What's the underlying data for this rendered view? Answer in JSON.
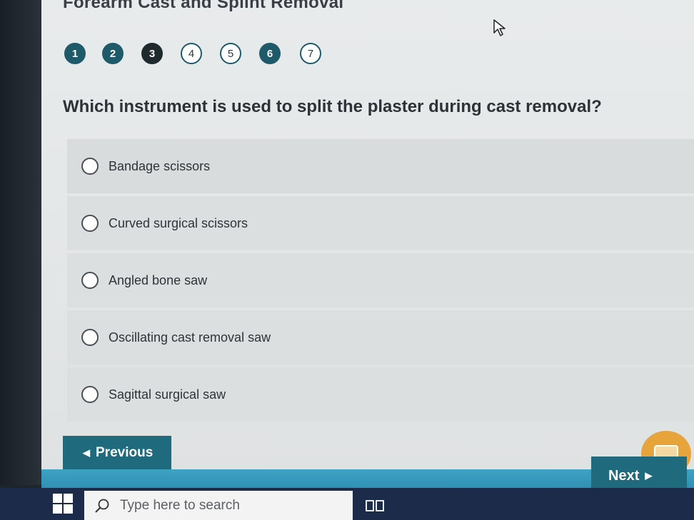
{
  "page": {
    "title": "Forearm Cast and Splint Removal"
  },
  "steps": [
    {
      "label": "1",
      "state": "done"
    },
    {
      "label": "2",
      "state": "done"
    },
    {
      "label": "3",
      "state": "current"
    },
    {
      "label": "4",
      "state": "todo"
    },
    {
      "label": "5",
      "state": "todo"
    },
    {
      "label": "6",
      "state": "done"
    },
    {
      "label": "7",
      "state": "todo"
    }
  ],
  "question": {
    "text": "Which instrument is used to split the plaster during cast removal?"
  },
  "options": [
    {
      "label": "Bandage scissors",
      "selected": false
    },
    {
      "label": "Curved surgical scissors",
      "selected": false
    },
    {
      "label": "Angled bone saw",
      "selected": false
    },
    {
      "label": "Oscillating cast removal saw",
      "selected": false
    },
    {
      "label": "Sagittal surgical saw",
      "selected": false
    }
  ],
  "nav": {
    "previous_label": "Previous",
    "next_label": "Next"
  },
  "taskbar": {
    "search_placeholder": "Type here to search"
  },
  "colors": {
    "accent": "#1f6a7d",
    "band": "#3fa3c4",
    "chat": "#e7a43b",
    "taskbar": "#1c2b4a"
  },
  "icons": {
    "cursor": "mouse-pointer-icon",
    "chat": "chat-bubble-icon",
    "windows": "windows-start-icon",
    "search": "search-icon",
    "task_view": "task-view-icon"
  }
}
